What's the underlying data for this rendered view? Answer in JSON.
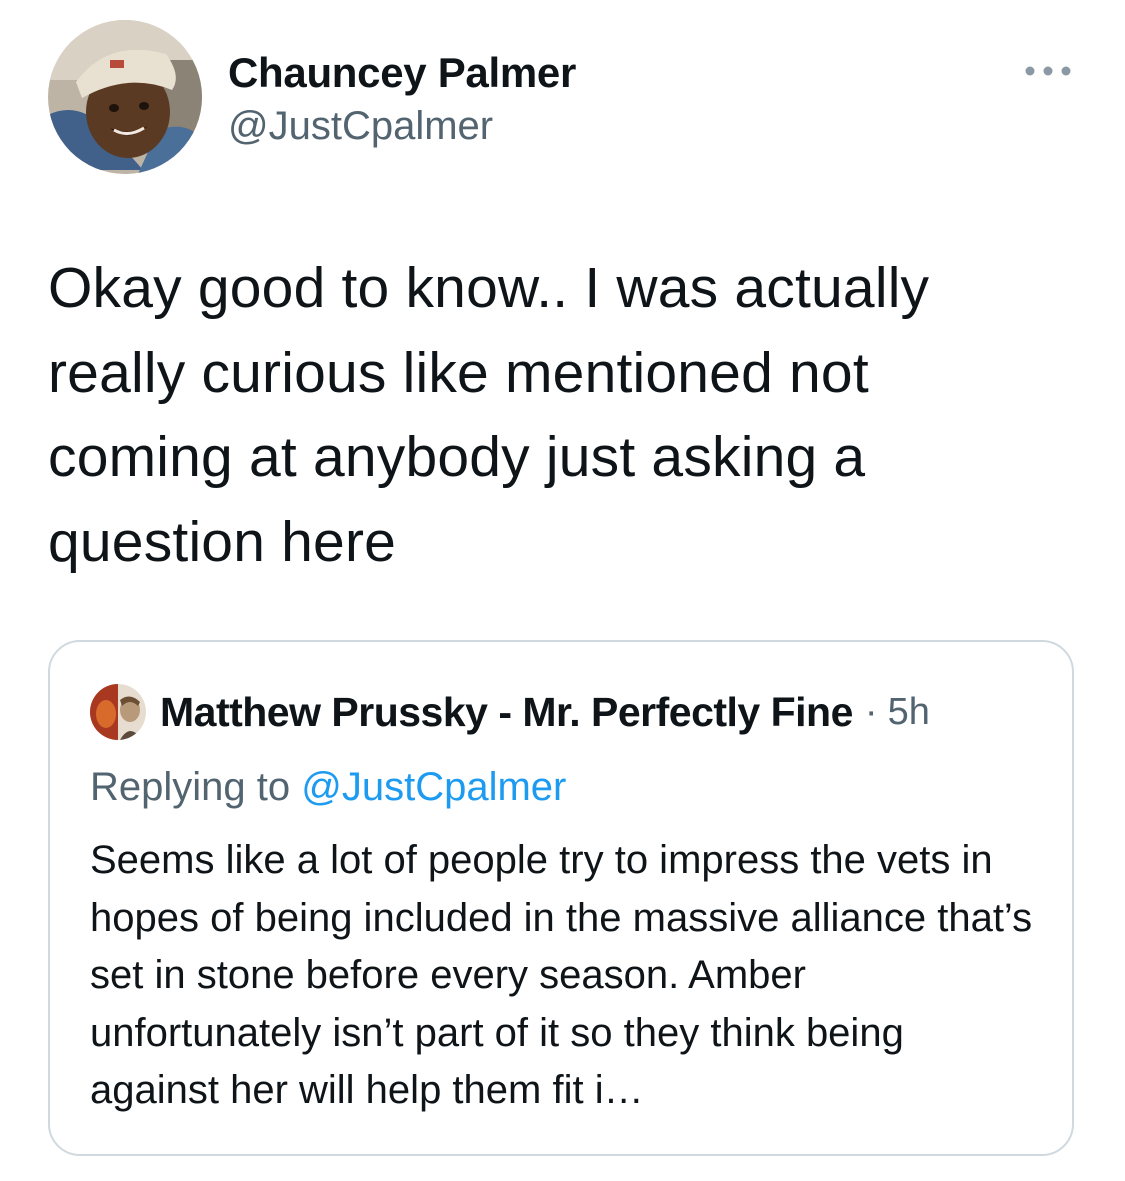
{
  "tweet": {
    "author_name": "Chauncey Palmer",
    "author_handle": "@JustCpalmer",
    "more_icon": "more-horizontal-icon",
    "text": "Okay good to know.. I was actually really curious like mentioned not coming at anybody just asking a question here"
  },
  "quoted_tweet": {
    "author_name": "Matthew Prussky - Mr. Perfectly Fine",
    "separator": "·",
    "time": "5h",
    "replying_prefix": "Replying to",
    "replying_handle": "@JustCpalmer",
    "text": "Seems like a lot of people try to impress the vets in hopes of being included in the massive alliance that’s set in stone before every season. Amber unfortunately isn’t part of it so they think being against her will help them fit i…"
  },
  "colors": {
    "text_primary": "#0f1419",
    "text_secondary": "#536471",
    "link": "#1d9bf0",
    "border": "#cfd9de"
  }
}
